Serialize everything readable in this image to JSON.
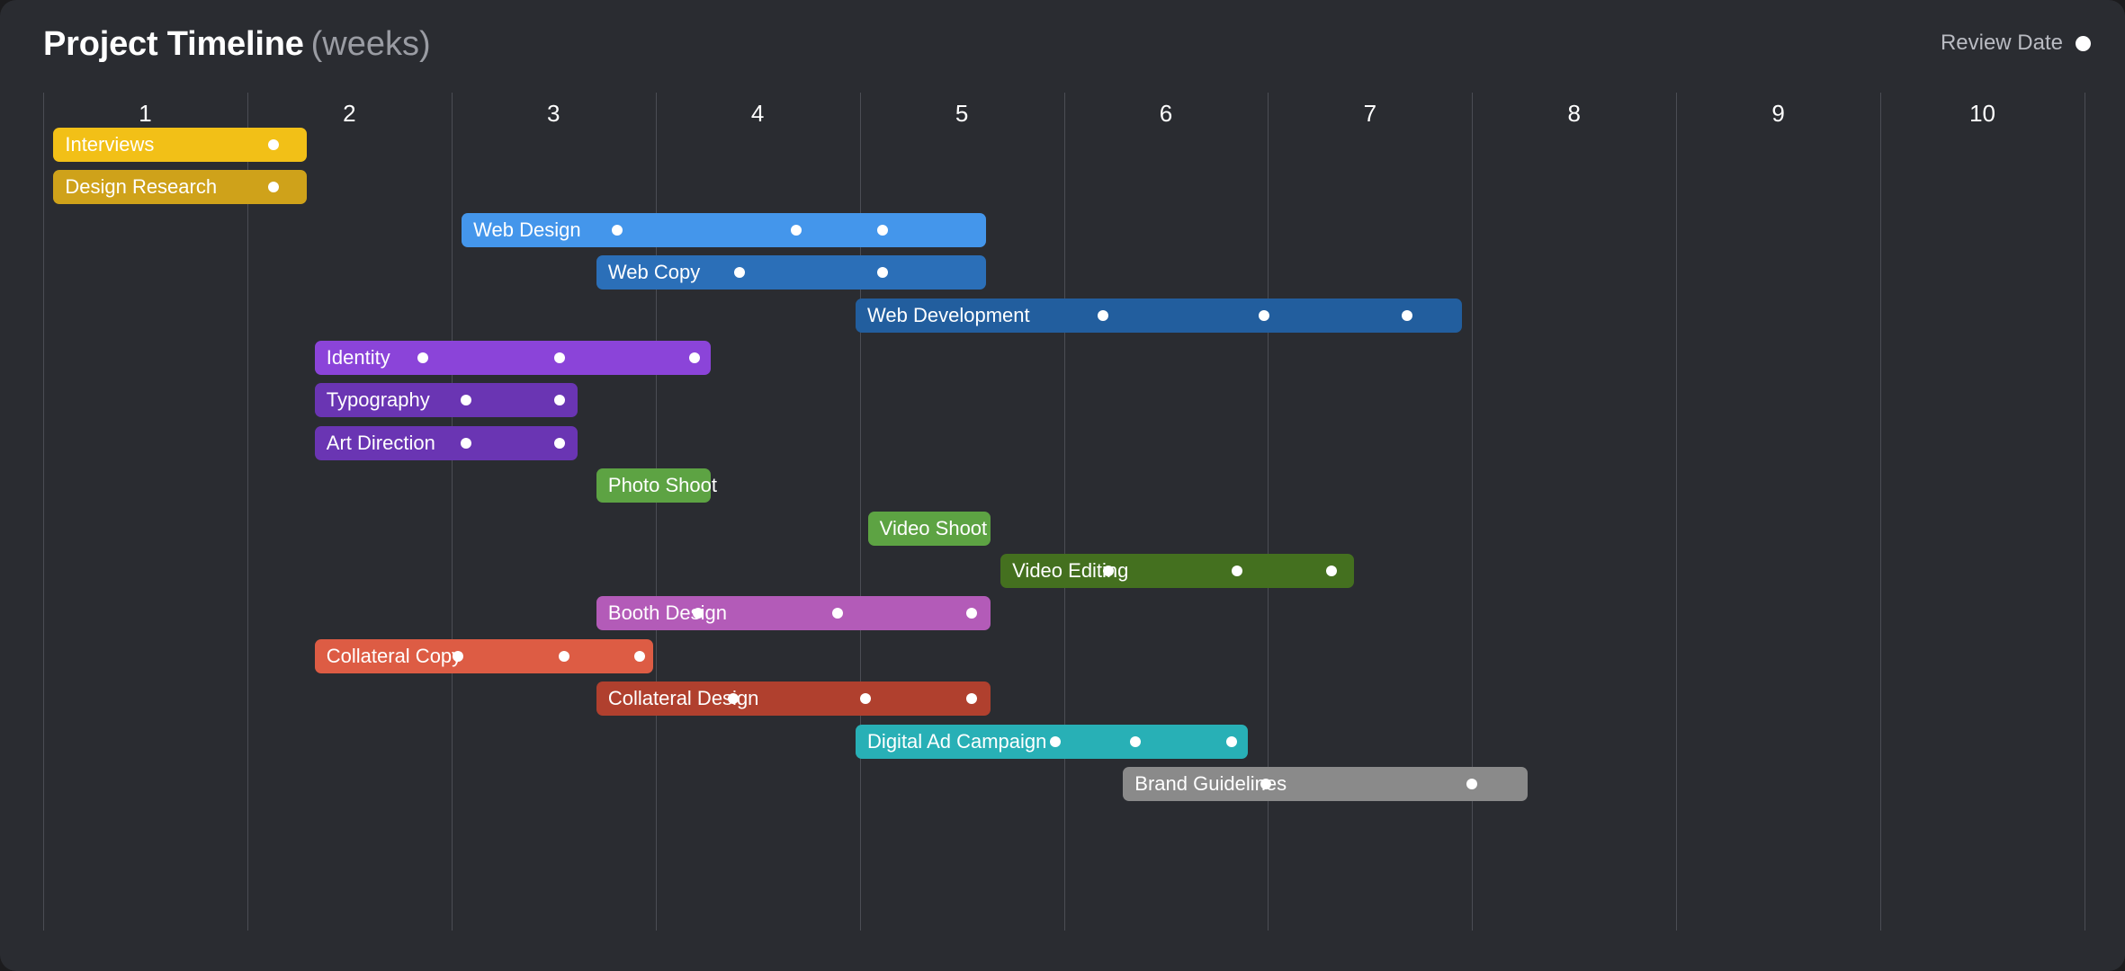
{
  "header": {
    "title_main": "Project Timeline",
    "title_sub": "(weeks)",
    "legend_label": "Review Date",
    "legend_icon": "review-date-dot-icon"
  },
  "theme": {
    "page_background": "#1c1c1e",
    "card_background": "#2a2c31",
    "grid_line": "#4b4d54",
    "week_label_color": "#ffffff",
    "title_color": "#ffffff",
    "subtitle_color": "#9a9ca3",
    "marker_color": "#ffffff"
  },
  "chart_data": {
    "type": "bar",
    "chart_kind": "gantt",
    "title": "Project Timeline (weeks)",
    "xlabel": "weeks",
    "ylabel": "",
    "xlim": [
      0,
      10
    ],
    "x_ticks": [
      1,
      2,
      3,
      4,
      5,
      6,
      7,
      8,
      9,
      10
    ],
    "x_tick_labels": [
      "1",
      "2",
      "3",
      "4",
      "5",
      "6",
      "7",
      "8",
      "9",
      "10"
    ],
    "grid": true,
    "legend": [
      {
        "label": "Review Date",
        "marker": "circle",
        "color": "#ffffff"
      }
    ],
    "legend_position": "top-right",
    "tasks": [
      {
        "name": "Interviews",
        "row": 0,
        "start": 0.05,
        "end": 1.29,
        "color": "#f2c017",
        "markers": [
          1.13
        ]
      },
      {
        "name": "Design Research",
        "row": 1,
        "start": 0.05,
        "end": 1.29,
        "color": "#cfa21a",
        "markers": [
          1.13
        ]
      },
      {
        "name": "Web Design",
        "row": 2,
        "start": 2.05,
        "end": 4.62,
        "color": "#4496eb",
        "markers": [
          2.81,
          3.69,
          4.11
        ]
      },
      {
        "name": "Web Copy",
        "row": 3,
        "start": 2.71,
        "end": 4.62,
        "color": "#2b6fb8",
        "markers": [
          3.41,
          4.11
        ]
      },
      {
        "name": "Web Development",
        "row": 4,
        "start": 3.98,
        "end": 6.95,
        "color": "#225e9e",
        "markers": [
          5.19,
          5.98,
          6.68
        ]
      },
      {
        "name": "Identity",
        "row": 5,
        "start": 1.33,
        "end": 3.27,
        "color": "#8b44d9",
        "markers": [
          1.86,
          2.53,
          3.19
        ]
      },
      {
        "name": "Typography",
        "row": 6,
        "start": 1.33,
        "end": 2.62,
        "color": "#6a35b3",
        "markers": [
          2.07,
          2.53
        ]
      },
      {
        "name": "Art Direction",
        "row": 7,
        "start": 1.33,
        "end": 2.62,
        "color": "#6a35b3",
        "markers": [
          2.07,
          2.53
        ]
      },
      {
        "name": "Photo Shoot",
        "row": 8,
        "start": 2.71,
        "end": 3.27,
        "color": "#5da343",
        "markers": []
      },
      {
        "name": "Video Shoot",
        "row": 9,
        "start": 4.04,
        "end": 4.64,
        "color": "#5da343",
        "markers": []
      },
      {
        "name": "Video Editing",
        "row": 10,
        "start": 4.69,
        "end": 6.42,
        "color": "#44701f",
        "markers": [
          5.22,
          5.85,
          6.31
        ]
      },
      {
        "name": "Booth Design",
        "row": 11,
        "start": 2.71,
        "end": 4.64,
        "color": "#b35bb8",
        "markers": [
          3.21,
          3.89,
          4.55
        ]
      },
      {
        "name": "Collateral Copy",
        "row": 12,
        "start": 1.33,
        "end": 2.99,
        "color": "#dd5c44",
        "markers": [
          2.03,
          2.55,
          2.92
        ]
      },
      {
        "name": "Collateral Design",
        "row": 13,
        "start": 2.71,
        "end": 4.64,
        "color": "#b0402e",
        "markers": [
          3.38,
          4.03,
          4.55
        ]
      },
      {
        "name": "Digital Ad Campaign",
        "row": 14,
        "start": 3.98,
        "end": 5.9,
        "color": "#28b0b6",
        "markers": [
          4.96,
          5.35,
          5.82
        ]
      },
      {
        "name": "Brand Guidelines",
        "row": 15,
        "start": 5.29,
        "end": 7.27,
        "color": "#8a8a8a",
        "markers": [
          5.99,
          7.0
        ]
      }
    ]
  }
}
